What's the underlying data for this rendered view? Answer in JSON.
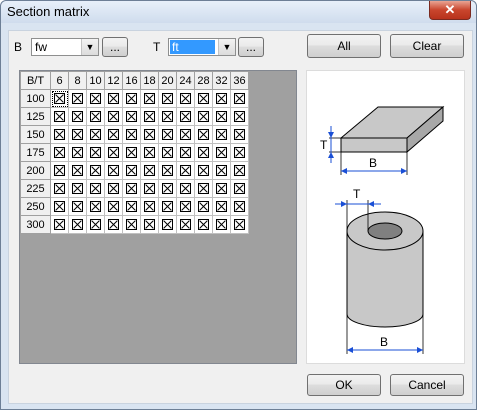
{
  "window": {
    "title": "Section matrix",
    "close_glyph": "✕"
  },
  "b_field": {
    "label": "B",
    "value": "fw",
    "browse_label": "..."
  },
  "t_field": {
    "label": "T",
    "value": "ft",
    "browse_label": "..."
  },
  "buttons": {
    "all": "All",
    "clear": "Clear",
    "ok": "OK",
    "cancel": "Cancel"
  },
  "matrix": {
    "corner": "B/T",
    "columns": [
      "6",
      "8",
      "10",
      "12",
      "16",
      "18",
      "20",
      "24",
      "28",
      "32",
      "36"
    ],
    "rows": [
      "100",
      "125",
      "150",
      "175",
      "200",
      "225",
      "250",
      "300"
    ],
    "highlighted_cell": {
      "row": "100",
      "column": "6"
    }
  },
  "figure": {
    "plate_t_label": "T",
    "plate_b_label": "B",
    "tube_t_label": "T",
    "tube_b_label": "B"
  },
  "colors": {
    "selection": "#3399ff",
    "grid_background": "#a0a0a0",
    "close_button": "#c9452d"
  }
}
